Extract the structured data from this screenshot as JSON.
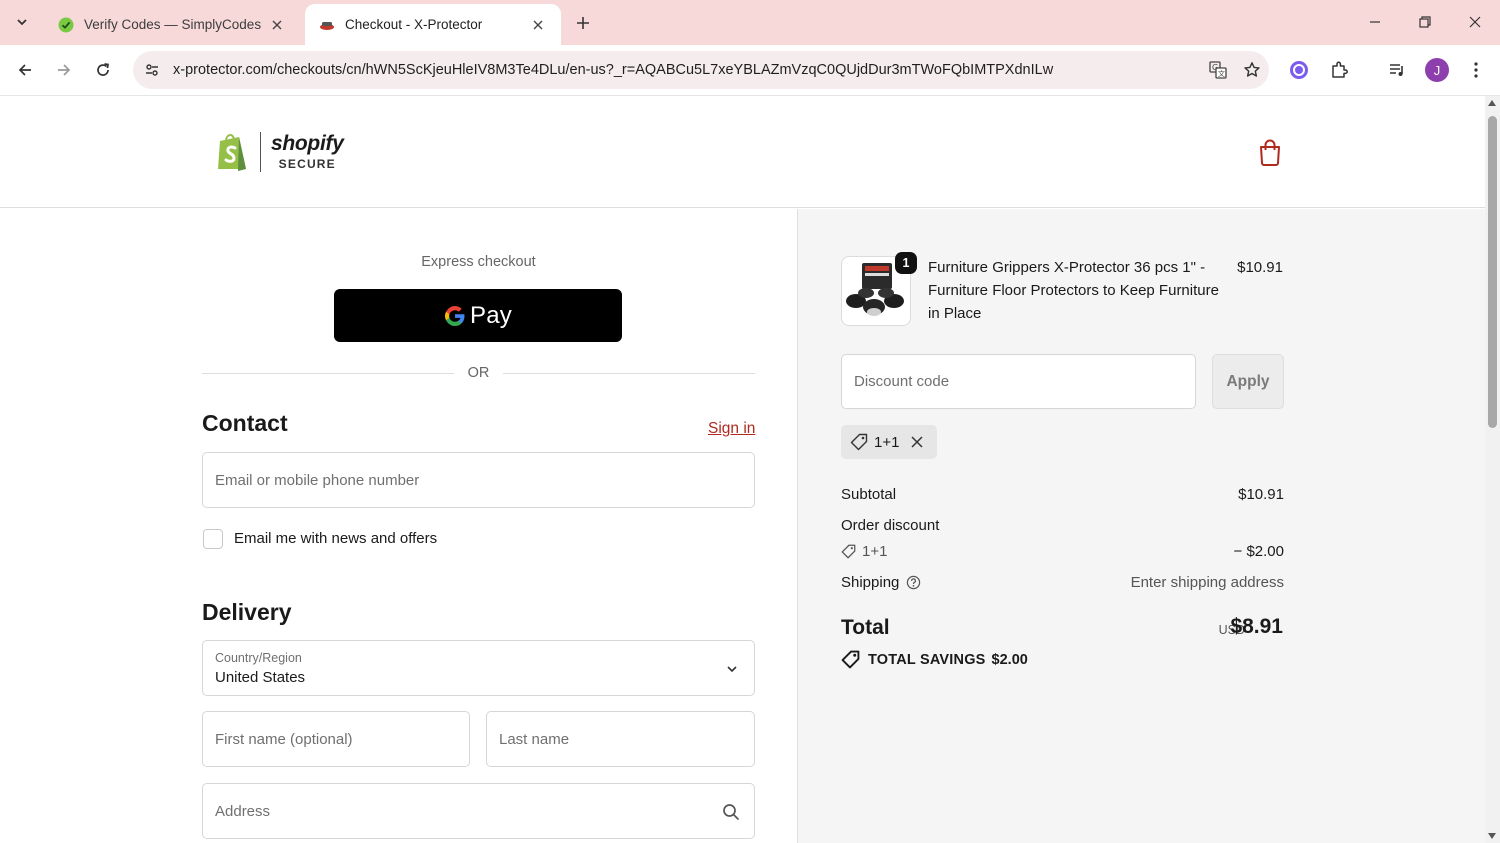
{
  "browser": {
    "tabs": [
      {
        "title": "Verify Codes — SimplyCodes",
        "active": false
      },
      {
        "title": "Checkout - X-Protector",
        "active": true
      }
    ],
    "url": "x-protector.com/checkouts/cn/hWN5ScKjeuHleIV8M3Te4DLu/en-us?_r=AQABCu5L7xeYBLAZmVzqC0QUjdDur3mTWoFQbIMTPXdnILw",
    "profile_initial": "J",
    "colors": {
      "tabstrip": "#f7d9d9",
      "avatar": "#8e3fae"
    }
  },
  "header": {
    "brand": "shopify",
    "brand_sub": "SECURE"
  },
  "checkout": {
    "express_label": "Express checkout",
    "gpay_label": "Pay",
    "or_label": "OR",
    "contact": {
      "title": "Contact",
      "sign_in": "Sign in",
      "email_placeholder": "Email or mobile phone number",
      "news_label": "Email me with news and offers"
    },
    "delivery": {
      "title": "Delivery",
      "country_label": "Country/Region",
      "country_value": "United States",
      "first_name_placeholder": "First name (optional)",
      "last_name_placeholder": "Last name",
      "address_placeholder": "Address"
    }
  },
  "summary": {
    "product": {
      "quantity": "1",
      "name": "Furniture Grippers X-Protector 36 pcs 1\" - Furniture Floor Protectors to Keep Furniture in Place",
      "price": "$10.91"
    },
    "discount_placeholder": "Discount code",
    "apply_label": "Apply",
    "applied_code": "1+1",
    "subtotal_label": "Subtotal",
    "subtotal_value": "$10.91",
    "order_discount_label": "Order discount",
    "discount_code": "1+1",
    "discount_value": "− $2.00",
    "shipping_label": "Shipping",
    "shipping_value": "Enter shipping address",
    "total_label": "Total",
    "currency": "USD",
    "total_value": "$8.91",
    "savings_label": "TOTAL SAVINGS",
    "savings_value": "$2.00",
    "accent": "#b02a1f"
  }
}
